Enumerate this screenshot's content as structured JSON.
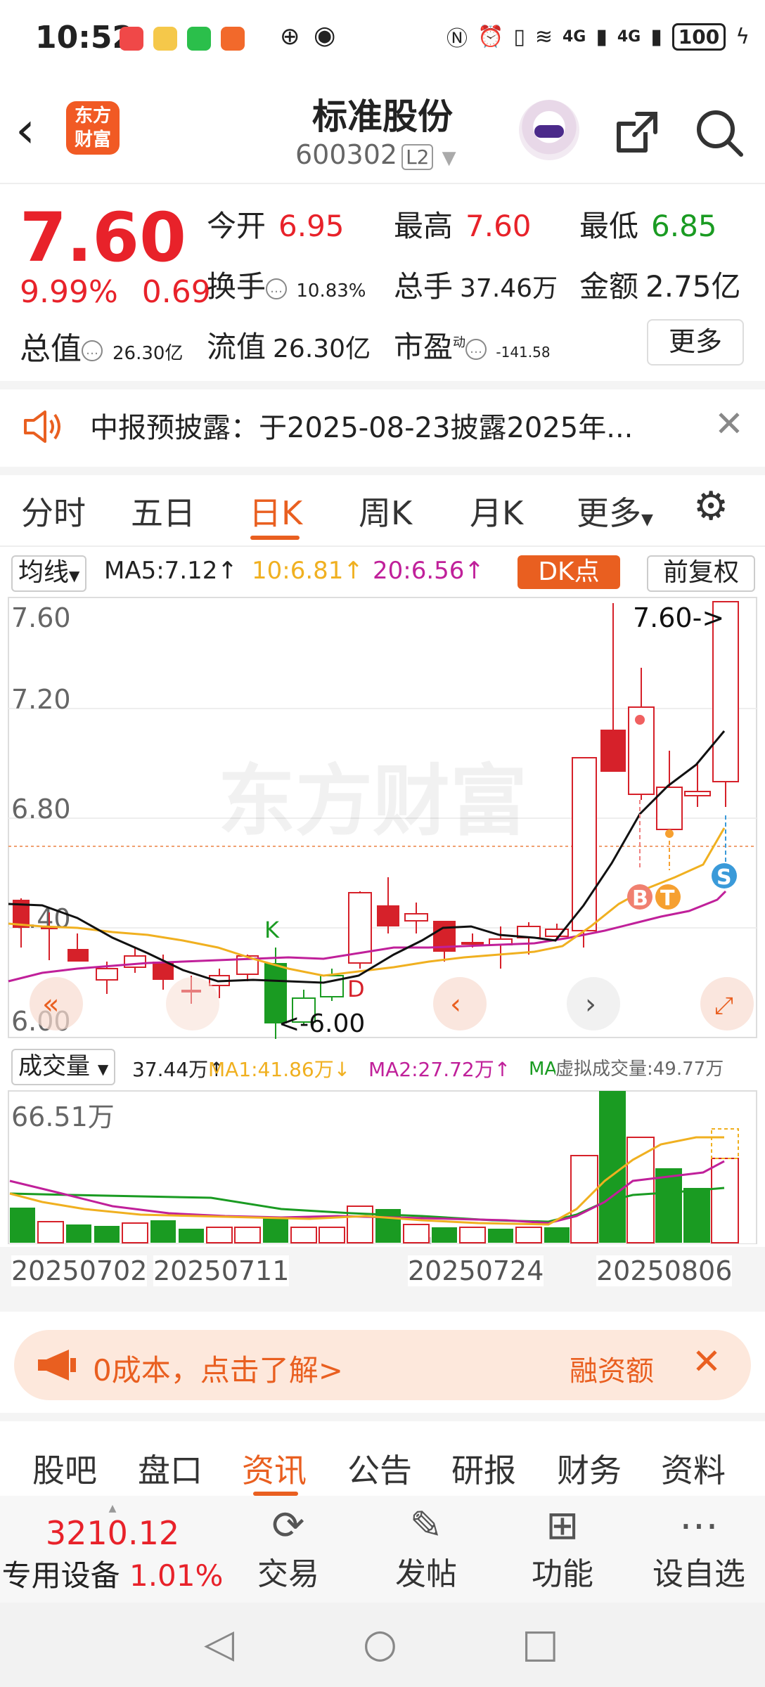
{
  "status": {
    "time": "10:52",
    "battery": "100",
    "net1": "4G",
    "net2": "4G"
  },
  "header": {
    "back_icon": "‹",
    "logo_line1": "东方",
    "logo_line2": "财富",
    "name": "标准股份",
    "code": "600302",
    "level": "L2"
  },
  "quote": {
    "price": "7.60",
    "change_pct": "9.99%",
    "change": "0.69",
    "open_label": "今开",
    "open": "6.95",
    "high_label": "最高",
    "high": "7.60",
    "low_label": "最低",
    "low": "6.85",
    "turnover_label": "换手",
    "turnover": "10.83%",
    "volume_label": "总手",
    "volume": "37.46万",
    "amount_label": "金额",
    "amount": "2.75亿",
    "mktcap_label": "总值",
    "mktcap": "26.30亿",
    "float_label": "流值",
    "float": "26.30亿",
    "pe_label": "市盈",
    "pe_sup": "动",
    "pe": "-141.58",
    "more": "更多"
  },
  "notice": {
    "text": "中报预披露：于2025-08-23披露2025年..."
  },
  "ktabs": [
    "分时",
    "五日",
    "日K",
    "周K",
    "月K",
    "更多"
  ],
  "ma": {
    "select": "均线",
    "ma5": "MA5:7.12↑",
    "ma10": "10:6.81↑",
    "ma20": "20:6.56↑",
    "dk": "DK点",
    "fq": "前复权"
  },
  "chart_labels": {
    "y760": "7.60",
    "y720": "7.20",
    "y680": "6.80",
    "y640": "6.40",
    "y600": "6.00",
    "last": "7.60->",
    "low": "<-6.00",
    "k": "K",
    "d": "D",
    "b": "B",
    "t": "T",
    "s": "S",
    "watermark": "东方财富"
  },
  "vol": {
    "select": "成交量",
    "v": "37.44万↑",
    "ma1": "MA1:41.86万↓",
    "ma2": "MA2:27.72万↑",
    "ma3": "MA3:18.92万↑",
    "virtual": "虚拟成交量:49.77万",
    "max": "66.51万"
  },
  "dates": [
    "20250702",
    "20250711",
    "20250724",
    "20250806"
  ],
  "promo": {
    "text": "0成本，点击了解>",
    "right": "融资额"
  },
  "btabs": [
    "股吧",
    "盘口",
    "资讯",
    "公告",
    "研报",
    "财务",
    "资料"
  ],
  "bottom": {
    "index": "3210.12",
    "sector": "专用设备",
    "sector_pct": "1.01%",
    "trade": "交易",
    "post": "发帖",
    "func": "功能",
    "watch": "设自选"
  },
  "colors": {
    "up": "#e8222a",
    "down": "#1a9b22",
    "accent": "#e95f20",
    "ma5": "#111111",
    "ma10": "#f0b020",
    "ma20": "#c0209a"
  }
}
